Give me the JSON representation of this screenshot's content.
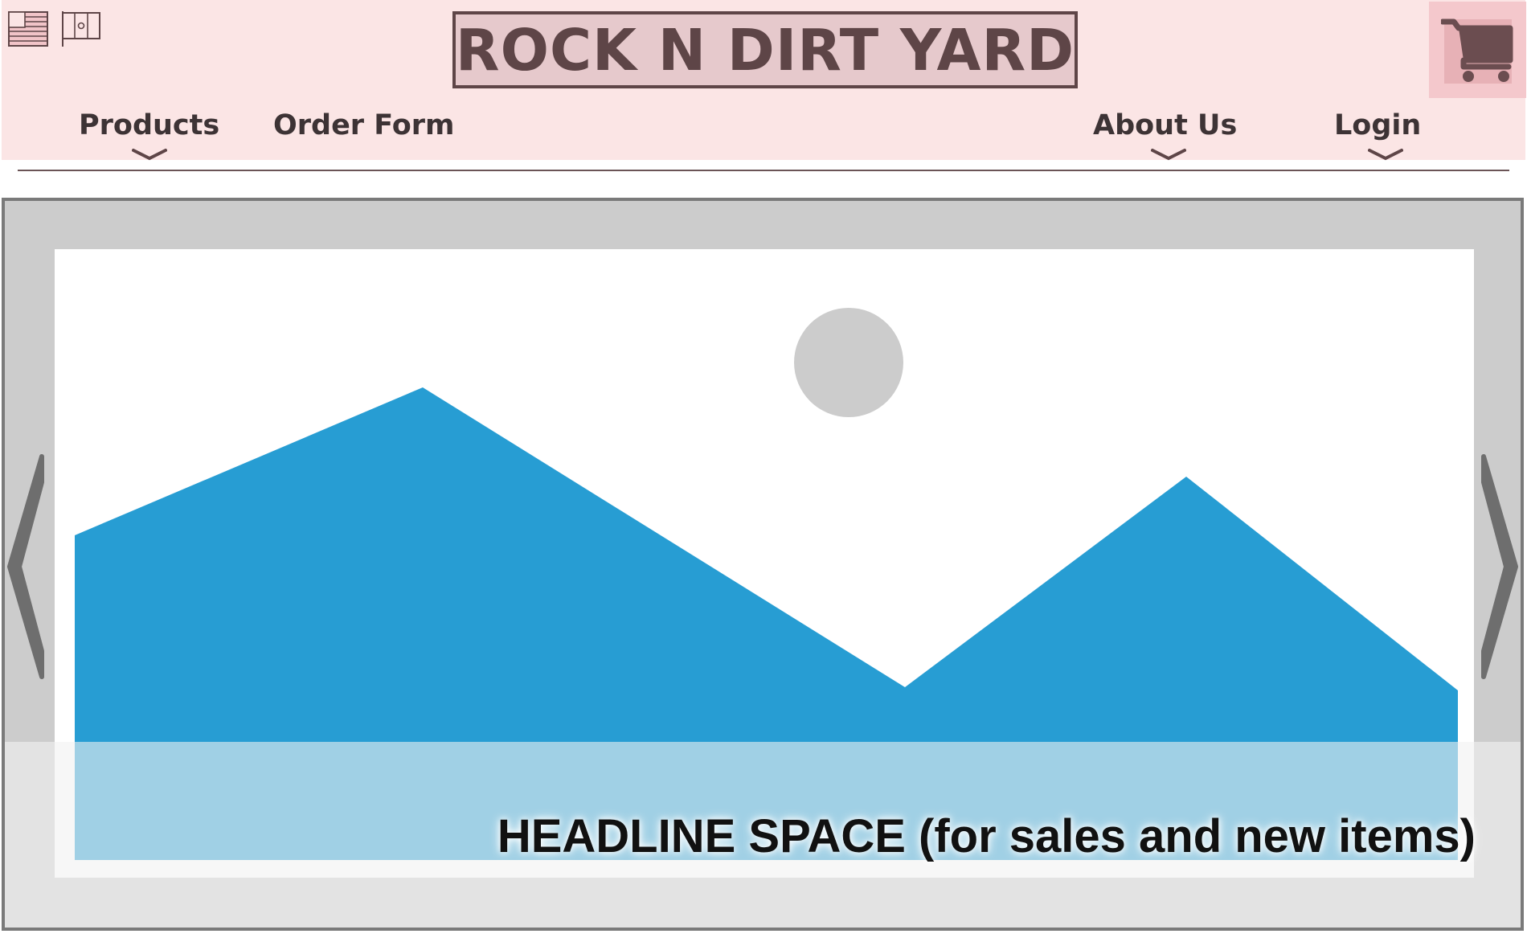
{
  "header": {
    "logo_text": "ROCK N DIRT YARD",
    "language_flags": [
      "us-flag-icon",
      "mx-flag-icon"
    ],
    "cart_icon": "shopping-cart-icon",
    "nav": {
      "products": "Products",
      "order_form": "Order Form",
      "about_us": "About Us",
      "login": "Login"
    }
  },
  "carousel": {
    "image_placeholder_icon": "image-placeholder-icon",
    "headline": "HEADLINE SPACE (for sales and new items)",
    "prev_icon": "chevron-left-icon",
    "next_icon": "chevron-right-icon"
  },
  "colors": {
    "header_bg": "#fbe5e5",
    "brand_dark": "#5e4547",
    "mountain_blue": "#279dd3",
    "carousel_frame": "#cccccc"
  }
}
